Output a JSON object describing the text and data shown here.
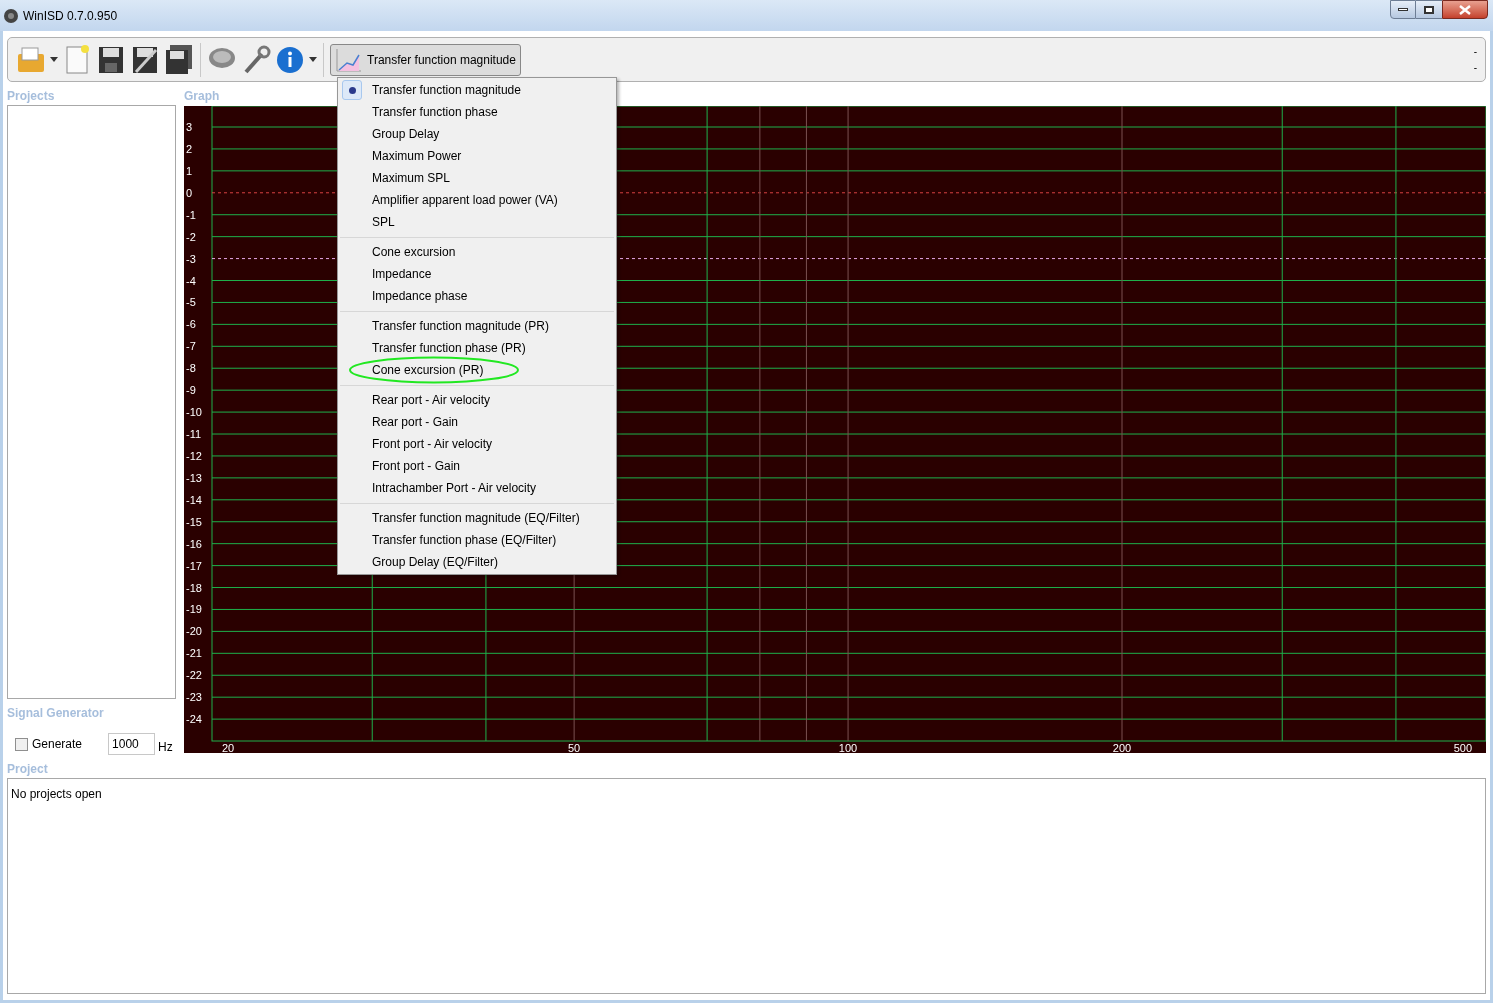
{
  "window": {
    "title": "WinISD 0.7.0.950"
  },
  "toolbar": {
    "graph_selector": {
      "label": "Transfer function magnitude",
      "expanded": true
    },
    "right_marks": [
      "-",
      "-"
    ]
  },
  "graph_menu": {
    "groups": [
      [
        {
          "label": "Transfer function magnitude",
          "selected": true,
          "circled": false
        },
        {
          "label": "Transfer function phase",
          "selected": false,
          "circled": false
        },
        {
          "label": "Group Delay",
          "selected": false,
          "circled": false
        },
        {
          "label": "Maximum Power",
          "selected": false,
          "circled": false
        },
        {
          "label": "Maximum SPL",
          "selected": false,
          "circled": false
        },
        {
          "label": "Amplifier apparent load power (VA)",
          "selected": false,
          "circled": false
        },
        {
          "label": "SPL",
          "selected": false,
          "circled": false
        }
      ],
      [
        {
          "label": "Cone excursion",
          "selected": false,
          "circled": false
        },
        {
          "label": "Impedance",
          "selected": false,
          "circled": false
        },
        {
          "label": "Impedance phase",
          "selected": false,
          "circled": false
        }
      ],
      [
        {
          "label": "Transfer function magnitude (PR)",
          "selected": false,
          "circled": false
        },
        {
          "label": "Transfer function phase (PR)",
          "selected": false,
          "circled": false
        },
        {
          "label": "Cone excursion (PR)",
          "selected": false,
          "circled": true
        }
      ],
      [
        {
          "label": "Rear port - Air velocity",
          "selected": false,
          "circled": false
        },
        {
          "label": "Rear port - Gain",
          "selected": false,
          "circled": false
        },
        {
          "label": "Front port - Air velocity",
          "selected": false,
          "circled": false
        },
        {
          "label": "Front port - Gain",
          "selected": false,
          "circled": false
        },
        {
          "label": "Intrachamber Port - Air velocity",
          "selected": false,
          "circled": false
        }
      ],
      [
        {
          "label": "Transfer function magnitude (EQ/Filter)",
          "selected": false,
          "circled": false
        },
        {
          "label": "Transfer function phase (EQ/Filter)",
          "selected": false,
          "circled": false
        },
        {
          "label": "Group Delay (EQ/Filter)",
          "selected": false,
          "circled": false
        }
      ]
    ]
  },
  "projects_panel": {
    "title": "Projects"
  },
  "signal_generator": {
    "title": "Signal Generator",
    "generate": {
      "label": "Generate",
      "checked": false
    },
    "frequency": "1000",
    "unit": "Hz"
  },
  "graph": {
    "title": "Graph",
    "y_labels": [
      "3",
      "2",
      "1",
      "0",
      "-1",
      "-2",
      "-3",
      "-4",
      "-5",
      "-6",
      "-7",
      "-8",
      "-9",
      "-10",
      "-11",
      "-12",
      "-13",
      "-14",
      "-15",
      "-16",
      "-17",
      "-18",
      "-19",
      "-20",
      "-21",
      "-22",
      "-23",
      "-24"
    ],
    "x_labels": [
      "20",
      "50",
      "100",
      "200",
      "500"
    ]
  },
  "project_panel": {
    "title": "Project",
    "text": "No projects open"
  }
}
